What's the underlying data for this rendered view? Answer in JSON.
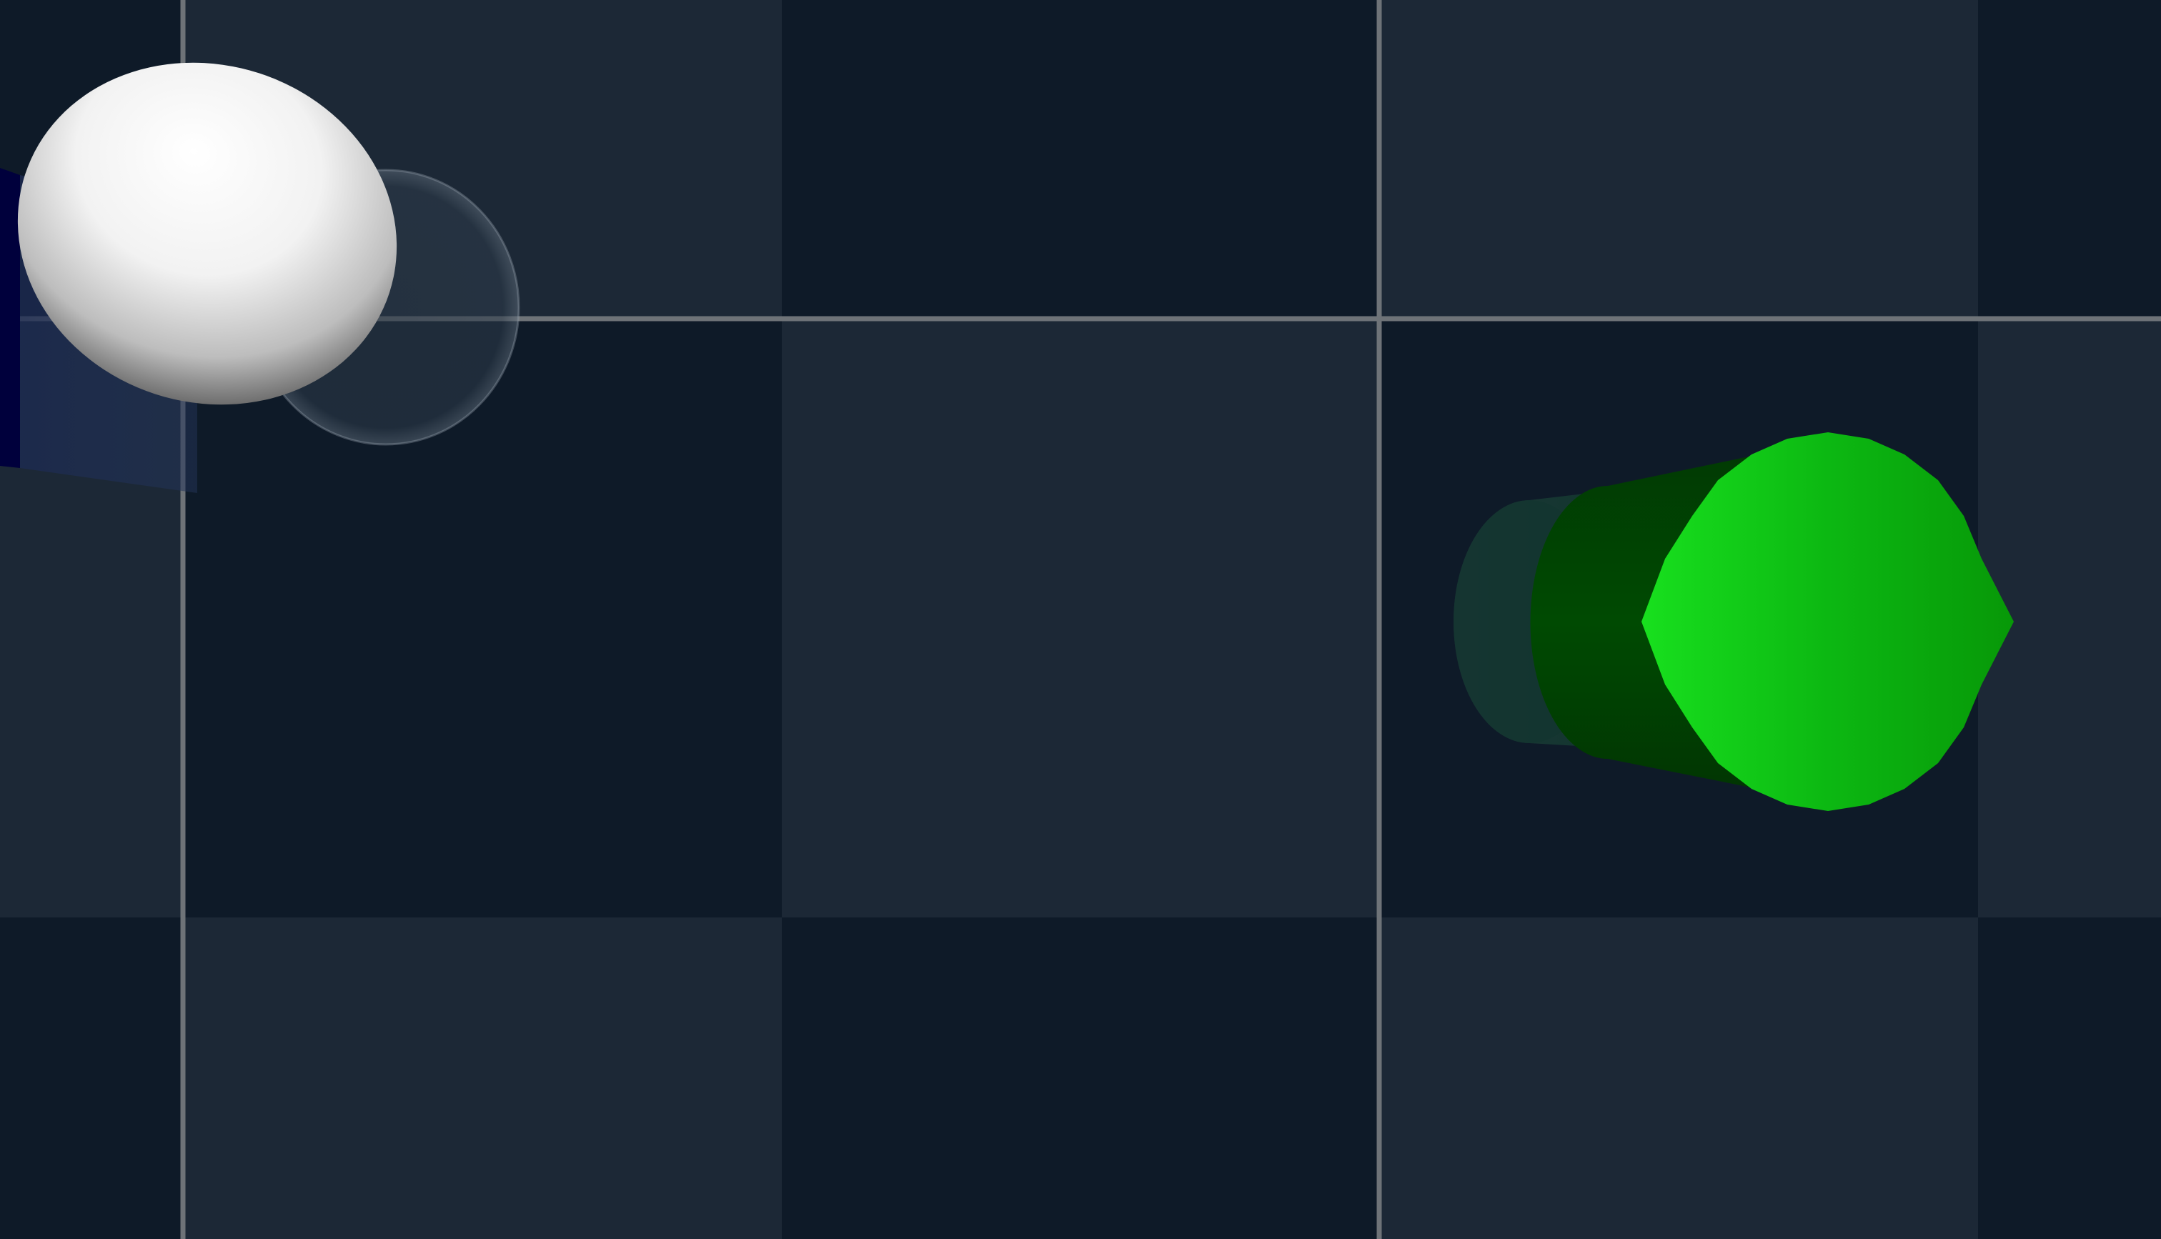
{
  "scene": {
    "type": "3d-viewport-top-down",
    "floor": {
      "pattern": "checkerboard",
      "colors": {
        "light_tile": "#1c2836",
        "dark_tile": "#0e1a28",
        "grid_line": "#6e7378"
      }
    },
    "objects": [
      {
        "id": "sphere",
        "shape": "ellipsoid",
        "color": "#ffffff",
        "shading": "glossy",
        "has_ghost_trail": true
      },
      {
        "id": "cylinder",
        "shape": "cylinder",
        "orientation": "end-on",
        "color": "#10b015",
        "has_ghost_trail": true
      },
      {
        "id": "box-edge",
        "shape": "box",
        "color": "#00003a",
        "partially_visible": true
      }
    ]
  }
}
